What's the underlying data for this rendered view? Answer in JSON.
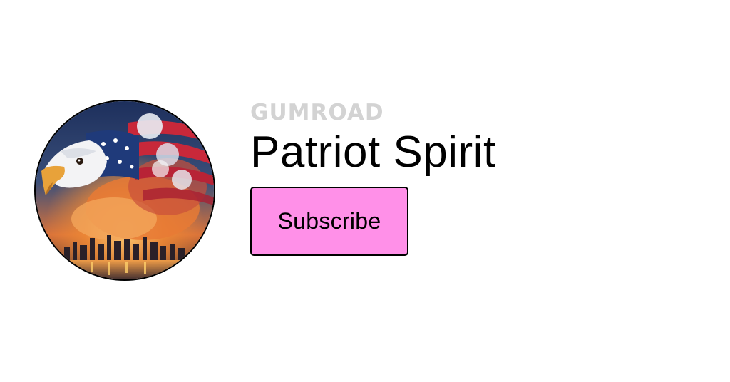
{
  "brand": {
    "logo_text": "GUMROAD",
    "logo_color": "#d3d3d3"
  },
  "profile": {
    "name": "Patriot Spirit",
    "avatar_icon": "eagle-flag-avatar"
  },
  "actions": {
    "subscribe_label": "Subscribe",
    "subscribe_color": "#ff90e8"
  }
}
